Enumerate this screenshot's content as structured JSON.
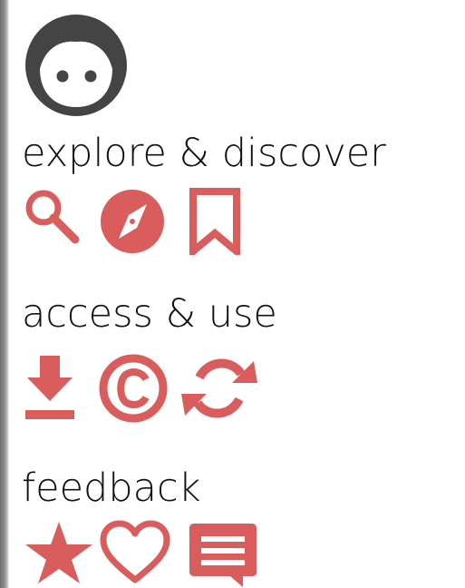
{
  "sections": [
    {
      "title": "explore & discover",
      "icons": [
        "search-icon",
        "compass-icon",
        "bookmark-icon"
      ]
    },
    {
      "title": "access & use",
      "icons": [
        "download-icon",
        "copyright-icon",
        "sync-icon"
      ]
    },
    {
      "title": "feedback",
      "icons": [
        "star-icon",
        "heart-icon",
        "comment-icon"
      ]
    }
  ],
  "colors": {
    "icon_accent": "#d95d5d",
    "avatar": "#444444",
    "text": "#111111"
  }
}
